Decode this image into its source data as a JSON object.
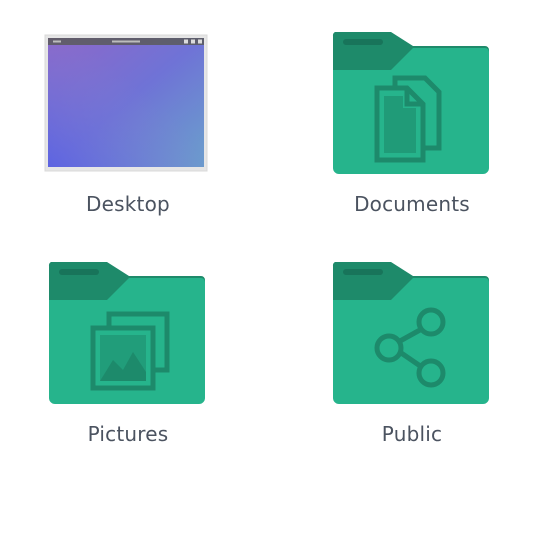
{
  "items": [
    {
      "label": "Desktop",
      "icon": "desktop-window-icon"
    },
    {
      "label": "Documents",
      "icon": "folder-documents-icon"
    },
    {
      "label": "Pictures",
      "icon": "folder-pictures-icon"
    },
    {
      "label": "Public",
      "icon": "folder-public-icon"
    }
  ],
  "colors": {
    "folder_front": "#26b48c",
    "folder_back": "#1e8a6a",
    "folder_glyph": "#1d8a6b",
    "label_text": "#4b5360"
  }
}
